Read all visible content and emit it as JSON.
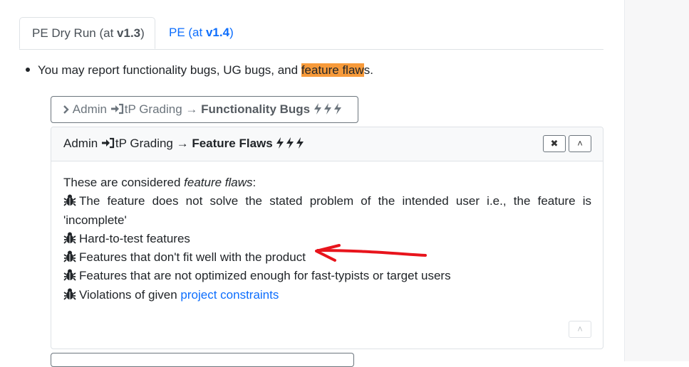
{
  "tabs": [
    {
      "prefix": "PE Dry Run (at ",
      "version": "v1.3",
      "suffix": ")"
    },
    {
      "prefix": "PE (at ",
      "version": "v1.4",
      "suffix": ")"
    }
  ],
  "intro": {
    "before": "You may report functionality bugs, UG bugs, and ",
    "highlight": "feature flaw",
    "after": "s."
  },
  "collapsed_item": {
    "prefix": "Admin ",
    "middle": "tP Grading → ",
    "bold": "Functionality Bugs",
    "bolts": "⚡⚡⚡"
  },
  "panel": {
    "title_prefix": "Admin ",
    "title_middle": "tP Grading → ",
    "title_bold": "Feature Flaws",
    "close_label": "✖",
    "collapse_label": "˄",
    "intro_before": "These are considered ",
    "intro_em": "feature flaws",
    "intro_after": ":",
    "items": [
      "The feature does not solve the stated problem of the intended user i.e., the feature is 'incomplete'",
      "Hard-to-test features",
      "Features that don't fit well with the product",
      "Features that are not optimized enough for fast-typists or target users"
    ],
    "last_item_before": "Violations of given ",
    "last_item_link": "project constraints",
    "bottom_collapse_label": "˄"
  },
  "annotation": {
    "color": "#e8141c"
  },
  "colors": {
    "accent": "#0d6efd",
    "highlight": "#f79a3a"
  }
}
